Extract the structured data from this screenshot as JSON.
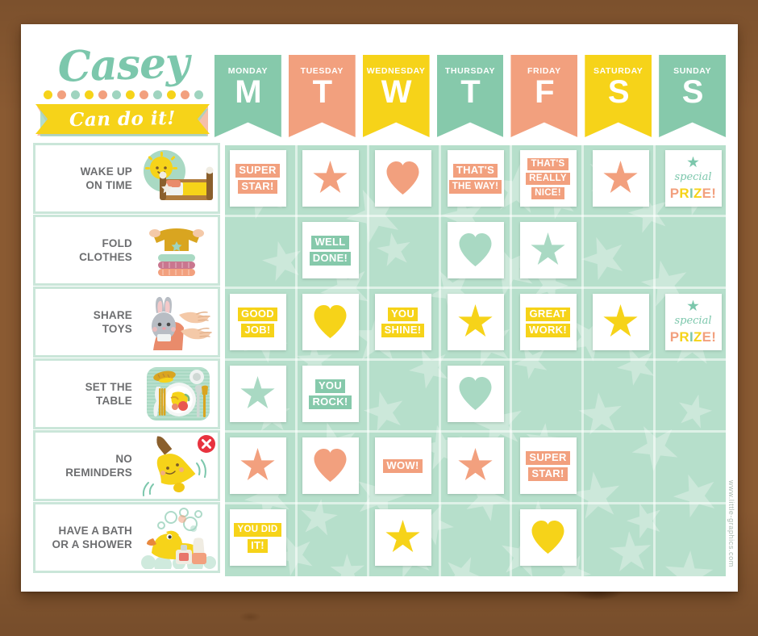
{
  "chart": {
    "child_name": "Casey",
    "motto": "Can do it!",
    "watermark": "www.little-graphics.com",
    "dot_colors": [
      "#f6d319",
      "#f2a07e",
      "#9fd4bf",
      "#f6d319",
      "#f2a07e",
      "#9fd4bf",
      "#f6d319",
      "#f2a07e",
      "#9fd4bf",
      "#f6d319",
      "#f2a07e",
      "#9fd4bf"
    ]
  },
  "palette": {
    "mint": "#86c9ab",
    "mint_light": "#b6dfcb",
    "peach": "#f2a07e",
    "yellow": "#f6d319",
    "paper": "#ffffff",
    "text_gray": "#6d6e70",
    "wood": "#b5824c"
  },
  "days": [
    {
      "name": "MONDAY",
      "letter": "M",
      "color": "#86c9ab"
    },
    {
      "name": "TUESDAY",
      "letter": "T",
      "color": "#f2a07e"
    },
    {
      "name": "WEDNESDAY",
      "letter": "W",
      "color": "#f6d319"
    },
    {
      "name": "THURSDAY",
      "letter": "T",
      "color": "#86c9ab"
    },
    {
      "name": "FRIDAY",
      "letter": "F",
      "color": "#f2a07e"
    },
    {
      "name": "SATURDAY",
      "letter": "S",
      "color": "#f6d319"
    },
    {
      "name": "SUNDAY",
      "letter": "S",
      "color": "#86c9ab"
    }
  ],
  "tasks": [
    {
      "label": "WAKE UP\nON TIME",
      "icon": "bed-and-sun-icon",
      "cells": [
        {
          "type": "text",
          "lines": [
            "SUPER",
            "STAR!"
          ],
          "color": "#f2a07e"
        },
        {
          "type": "star",
          "color": "#f2a07e"
        },
        {
          "type": "heart",
          "color": "#f2a07e"
        },
        {
          "type": "text",
          "lines": [
            "THAT'S",
            "THE WAY!"
          ],
          "color": "#f2a07e"
        },
        {
          "type": "text",
          "lines": [
            "THAT'S",
            "REALLY",
            "NICE!"
          ],
          "color": "#f2a07e"
        },
        {
          "type": "star",
          "color": "#f2a07e"
        },
        {
          "type": "prize",
          "special": "special",
          "word": "PRIZE!"
        }
      ]
    },
    {
      "label": "FOLD\nCLOTHES",
      "icon": "folded-clothes-icon",
      "cells": [
        {
          "type": "empty"
        },
        {
          "type": "text",
          "lines": [
            "WELL",
            "DONE!"
          ],
          "color": "#86c9ab"
        },
        {
          "type": "empty"
        },
        {
          "type": "heart",
          "color": "#a9d9c3"
        },
        {
          "type": "star",
          "color": "#a9d9c3"
        },
        {
          "type": "empty"
        },
        {
          "type": "empty"
        }
      ]
    },
    {
      "label": "SHARE\nTOYS",
      "icon": "bunny-sharing-icon",
      "cells": [
        {
          "type": "text",
          "lines": [
            "GOOD",
            "JOB!"
          ],
          "color": "#f6d319"
        },
        {
          "type": "heart",
          "color": "#f6d319"
        },
        {
          "type": "text",
          "lines": [
            "YOU",
            "SHINE!"
          ],
          "color": "#f6d319"
        },
        {
          "type": "star",
          "color": "#f6d319"
        },
        {
          "type": "text",
          "lines": [
            "GREAT",
            "WORK!"
          ],
          "color": "#f6d319"
        },
        {
          "type": "star",
          "color": "#f6d319"
        },
        {
          "type": "prize",
          "special": "special",
          "word": "PRIZE!"
        }
      ]
    },
    {
      "label": "SET THE\nTABLE",
      "icon": "place-setting-icon",
      "cells": [
        {
          "type": "star",
          "color": "#a9d9c3"
        },
        {
          "type": "text",
          "lines": [
            "YOU",
            "ROCK!"
          ],
          "color": "#86c9ab"
        },
        {
          "type": "empty"
        },
        {
          "type": "heart",
          "color": "#a9d9c3"
        },
        {
          "type": "empty"
        },
        {
          "type": "empty"
        },
        {
          "type": "empty"
        }
      ]
    },
    {
      "label": "NO\nREMINDERS",
      "icon": "bell-no-reminders-icon",
      "cells": [
        {
          "type": "star",
          "color": "#f2a07e"
        },
        {
          "type": "heart",
          "color": "#f2a07e"
        },
        {
          "type": "text",
          "lines": [
            "WOW!"
          ],
          "color": "#f2a07e"
        },
        {
          "type": "star",
          "color": "#f2a07e"
        },
        {
          "type": "text",
          "lines": [
            "SUPER",
            "STAR!"
          ],
          "color": "#f2a07e"
        },
        {
          "type": "empty"
        },
        {
          "type": "empty"
        }
      ]
    },
    {
      "label": "HAVE A BATH\nOR A SHOWER",
      "icon": "rubber-duck-bath-icon",
      "cells": [
        {
          "type": "text",
          "lines": [
            "YOU DID",
            "IT!"
          ],
          "color": "#f6d319"
        },
        {
          "type": "empty"
        },
        {
          "type": "star",
          "color": "#f6d319"
        },
        {
          "type": "empty"
        },
        {
          "type": "heart",
          "color": "#f6d319"
        },
        {
          "type": "empty"
        },
        {
          "type": "empty"
        }
      ]
    }
  ]
}
